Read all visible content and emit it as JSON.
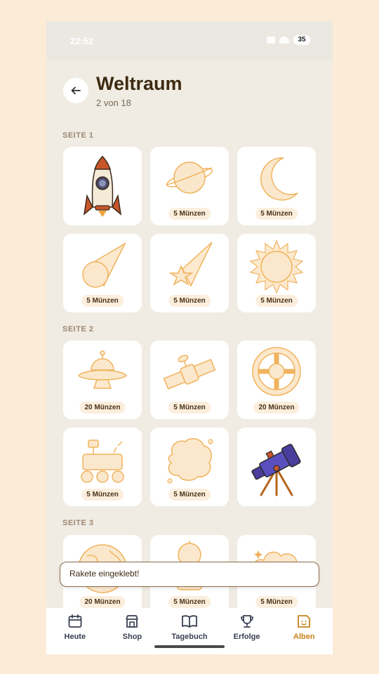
{
  "status_bar": {
    "time": "22:52",
    "battery": "35"
  },
  "header": {
    "title": "Weltraum",
    "subtitle": "2 von 18",
    "back_icon": "arrow-left-icon"
  },
  "sections": [
    {
      "label": "SEITE 1"
    },
    {
      "label": "SEITE 2"
    },
    {
      "label": "SEITE 3"
    }
  ],
  "stickers": [
    {
      "name": "rakete",
      "owned": true,
      "price": ""
    },
    {
      "name": "planet",
      "owned": false,
      "price": "5 Münzen"
    },
    {
      "name": "mond",
      "owned": false,
      "price": "5 Münzen"
    },
    {
      "name": "komet",
      "owned": false,
      "price": "5 Münzen"
    },
    {
      "name": "sternschnuppe",
      "owned": false,
      "price": "5 Münzen"
    },
    {
      "name": "sonne",
      "owned": false,
      "price": "5 Münzen"
    },
    {
      "name": "ufo",
      "owned": false,
      "price": "20 Münzen"
    },
    {
      "name": "satellit",
      "owned": false,
      "price": "5 Münzen"
    },
    {
      "name": "raumstation",
      "owned": false,
      "price": "20 Münzen"
    },
    {
      "name": "rover",
      "owned": false,
      "price": "5 Münzen"
    },
    {
      "name": "nebel",
      "owned": false,
      "price": "5 Münzen"
    },
    {
      "name": "teleskop",
      "owned": true,
      "price": ""
    },
    {
      "name": "erde",
      "owned": false,
      "price": "20 Münzen"
    },
    {
      "name": "astronaut",
      "owned": false,
      "price": "5 Münzen"
    },
    {
      "name": "wolke",
      "owned": false,
      "price": "5 Münzen"
    }
  ],
  "toast": {
    "message": "Rakete eingeklebt!"
  },
  "nav": {
    "items": [
      {
        "label": "Heute",
        "icon": "calendar-icon"
      },
      {
        "label": "Shop",
        "icon": "store-icon"
      },
      {
        "label": "Tagebuch",
        "icon": "book-icon"
      },
      {
        "label": "Erfolge",
        "icon": "trophy-icon"
      },
      {
        "label": "Alben",
        "icon": "album-icon"
      }
    ],
    "active": "Alben"
  },
  "colors": {
    "background": "#fcebd6",
    "accent": "#c98218",
    "locked_stroke": "#f0b35d",
    "locked_fill": "#fbe8cc",
    "title": "#3d2a12"
  }
}
